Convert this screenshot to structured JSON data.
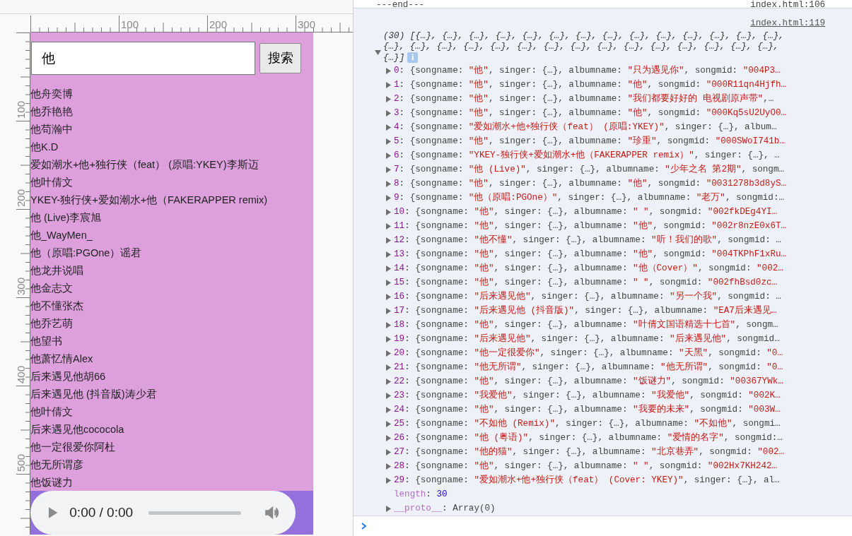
{
  "ruler": {
    "h_labels": [
      "100",
      "200",
      "300"
    ],
    "v_labels": [
      "100",
      "200",
      "300",
      "400",
      "500"
    ]
  },
  "app": {
    "search": {
      "value": "他"
    },
    "button": "搜索",
    "results": [
      {
        "text": "他舟奕博"
      },
      {
        "text": "他乔艳艳"
      },
      {
        "text": "他苟瀚中"
      },
      {
        "text": "他K.D"
      },
      {
        "text": "爱如潮水+他+独行侠（feat） (原唱:YKEY)李斯迈"
      },
      {
        "text": "他叶倩文"
      },
      {
        "text": "YKEY-独行侠+爱如潮水+他（FAKERAPPER remix)"
      },
      {
        "text": "他 (Live)李宸旭"
      },
      {
        "text": "他_WayMen_"
      },
      {
        "text": "他（原唱:PGOne）谣君"
      },
      {
        "text": "他龙井说唱"
      },
      {
        "text": "他金志文"
      },
      {
        "text": "他不懂张杰"
      },
      {
        "text": "他乔艺萌"
      },
      {
        "text": "他望书"
      },
      {
        "text": "他萧忆情Alex"
      },
      {
        "text": "后来遇见他胡66"
      },
      {
        "text": "后来遇见他 (抖音版)涛少君"
      },
      {
        "text": "他叶倩文"
      },
      {
        "text": "后来遇见他cococola"
      },
      {
        "text": "他一定很爱你阿杜"
      },
      {
        "text": "他无所谓彦"
      },
      {
        "text": "他饭谜力"
      }
    ],
    "player": {
      "time": "0:00 / 0:00"
    }
  },
  "console": {
    "prev": {
      "text": "---end---",
      "source": "index.html:106"
    },
    "source": "index.html:119",
    "summary": {
      "expanded": true,
      "lines": [
        "(30) [{…}, {…}, {…}, {…}, {…}, {…}, {…}, {…}, {…}, {…}, {…}, {…}, {…}, {…},",
        "{…}, {…}, {…}, {…}, {…}, {…}, {…}, {…}, {…}, {…}, {…}, {…}, {…}, {…}, {…},",
        "{…}]"
      ],
      "info": "i"
    },
    "rows": [
      {
        "index": "0",
        "expanded": false,
        "parts": [
          ": {songname: ",
          "\"他\"",
          ", singer: {…}, albumname: ",
          "\"只为遇见你\"",
          ", songmid: ",
          "\"004P3…"
        ]
      },
      {
        "index": "1",
        "expanded": false,
        "parts": [
          ": {songname: ",
          "\"他\"",
          ", singer: {…}, albumname: ",
          "\"他\"",
          ", songmid: ",
          "\"000R11qn4Hjfh…"
        ]
      },
      {
        "index": "2",
        "expanded": false,
        "parts": [
          ": {songname: ",
          "\"他\"",
          ", singer: {…}, albumname: ",
          "\"我们都要好好的 电视剧原声带\"",
          ",…"
        ]
      },
      {
        "index": "3",
        "expanded": false,
        "parts": [
          ": {songname: ",
          "\"他\"",
          ", singer: {…}, albumname: ",
          "\"他\"",
          ", songmid: ",
          "\"000Kq5sU2UyO0…"
        ]
      },
      {
        "index": "4",
        "expanded": false,
        "parts": [
          ": {songname: ",
          "\"爱如潮水+他+独行侠（feat） (原唱:YKEY)\"",
          ", singer: {…}, album…"
        ]
      },
      {
        "index": "5",
        "expanded": false,
        "parts": [
          ": {songname: ",
          "\"他\"",
          ", singer: {…}, albumname: ",
          "\"珍重\"",
          ", songmid: ",
          "\"000SWoI741b…"
        ]
      },
      {
        "index": "6",
        "expanded": false,
        "parts": [
          ": {songname: ",
          "\"YKEY-独行侠+爱如潮水+他（FAKERAPPER remix）\"",
          ", singer: {…}, …"
        ]
      },
      {
        "index": "7",
        "expanded": false,
        "parts": [
          ": {songname: ",
          "\"他 (Live)\"",
          ", singer: {…}, albumname: ",
          "\"少年之名 第2期\"",
          ", songm…"
        ]
      },
      {
        "index": "8",
        "expanded": false,
        "parts": [
          ": {songname: ",
          "\"他\"",
          ", singer: {…}, albumname: ",
          "\"他\"",
          ", songmid: ",
          "\"0031278b3d8yS…"
        ]
      },
      {
        "index": "9",
        "expanded": false,
        "parts": [
          ": {songname: ",
          "\"他（原唱:PGOne）\"",
          ", singer: {…}, albumname: ",
          "\"老万\"",
          ", songmid:…"
        ]
      },
      {
        "index": "10",
        "expanded": false,
        "parts": [
          ": {songname: ",
          "\"他\"",
          ", singer: {…}, albumname: ",
          "\"   \"",
          ", songmid: ",
          "\"002fkDEg4YI…"
        ]
      },
      {
        "index": "11",
        "expanded": false,
        "parts": [
          ": {songname: ",
          "\"他\"",
          ", singer: {…}, albumname: ",
          "\"他\"",
          ", songmid: ",
          "\"002r8nzE0x6T…"
        ]
      },
      {
        "index": "12",
        "expanded": false,
        "parts": [
          ": {songname: ",
          "\"他不懂\"",
          ", singer: {…}, albumname: ",
          "\"听！我们的歌\"",
          ", songmid: …"
        ]
      },
      {
        "index": "13",
        "expanded": false,
        "parts": [
          ": {songname: ",
          "\"他\"",
          ", singer: {…}, albumname: ",
          "\"他\"",
          ", songmid: ",
          "\"004TKPhF1xRu…"
        ]
      },
      {
        "index": "14",
        "expanded": false,
        "parts": [
          ": {songname: ",
          "\"他\"",
          ", singer: {…}, albumname: ",
          "\"他（Cover）\"",
          ", songmid: ",
          "\"002…"
        ]
      },
      {
        "index": "15",
        "expanded": false,
        "parts": [
          ": {songname: ",
          "\"他\"",
          ", singer: {…}, albumname: ",
          "\"   \"",
          ", songmid: ",
          "\"002fhBsd0zc…"
        ]
      },
      {
        "index": "16",
        "expanded": false,
        "parts": [
          ": {songname: ",
          "\"后来遇见他\"",
          ", singer: {…}, albumname: ",
          "\"另一个我\"",
          ", songmid: …"
        ]
      },
      {
        "index": "17",
        "expanded": false,
        "parts": [
          ": {songname: ",
          "\"后来遇见他 (抖音版)\"",
          ", singer: {…}, albumname: ",
          "\"EA7后来遇见…"
        ]
      },
      {
        "index": "18",
        "expanded": false,
        "parts": [
          ": {songname: ",
          "\"他\"",
          ", singer: {…}, albumname: ",
          "\"叶倩文国语精选十七首\"",
          ", songm…"
        ]
      },
      {
        "index": "19",
        "expanded": false,
        "parts": [
          ": {songname: ",
          "\"后来遇见他\"",
          ", singer: {…}, albumname: ",
          "\"后来遇见他\"",
          ", songmid…"
        ]
      },
      {
        "index": "20",
        "expanded": false,
        "parts": [
          ": {songname: ",
          "\"他一定很爱你\"",
          ", singer: {…}, albumname: ",
          "\"天黑\"",
          ", songmid: ",
          "\"0…"
        ]
      },
      {
        "index": "21",
        "expanded": false,
        "parts": [
          ": {songname: ",
          "\"他无所谓\"",
          ", singer: {…}, albumname: ",
          "\"他无所谓\"",
          ", songmid: ",
          "\"0…"
        ]
      },
      {
        "index": "22",
        "expanded": false,
        "parts": [
          ": {songname: ",
          "\"他\"",
          ", singer: {…}, albumname: ",
          "\"饭谜力\"",
          ", songmid: ",
          "\"00367YWk…"
        ]
      },
      {
        "index": "23",
        "expanded": false,
        "parts": [
          ": {songname: ",
          "\"我爱他\"",
          ", singer: {…}, albumname: ",
          "\"我爱他\"",
          ", songmid: ",
          "\"002K…"
        ]
      },
      {
        "index": "24",
        "expanded": false,
        "parts": [
          ": {songname: ",
          "\"他\"",
          ", singer: {…}, albumname: ",
          "\"我要的未来\"",
          ", songmid: ",
          "\"003W…"
        ]
      },
      {
        "index": "25",
        "expanded": false,
        "parts": [
          ": {songname: ",
          "\"不如他 (Remix)\"",
          ", singer: {…}, albumname: ",
          "\"不如他\"",
          ", songmi…"
        ]
      },
      {
        "index": "26",
        "expanded": false,
        "parts": [
          ": {songname: ",
          "\"他 (粤语)\"",
          ", singer: {…}, albumname: ",
          "\"爱情的名字\"",
          ", songmid:…"
        ]
      },
      {
        "index": "27",
        "expanded": false,
        "parts": [
          ": {songname: ",
          "\"他的猫\"",
          ", singer: {…}, albumname: ",
          "\"北京巷弄\"",
          ", songmid: ",
          "\"002…"
        ]
      },
      {
        "index": "28",
        "expanded": false,
        "parts": [
          ": {songname: ",
          "\"他\"",
          ", singer: {…}, albumname: ",
          "\"   \"",
          ", songmid: ",
          "\"002Hx7KH242…"
        ]
      },
      {
        "index": "29",
        "expanded": false,
        "parts": [
          ": {songname: ",
          "\"爱如潮水+他+独行侠（feat） (Cover: YKEY)\"",
          ", singer: {…}, al…"
        ]
      }
    ],
    "length": [
      {
        "kind": "prop",
        "text": "length"
      },
      {
        "kind": "punct",
        "text": ": "
      },
      {
        "kind": "number",
        "text": "30"
      }
    ],
    "proto": {
      "expanded": false,
      "parts": [
        {
          "kind": "prop",
          "text": "__proto__"
        },
        {
          "kind": "punct",
          "text": ": Array(0)"
        }
      ]
    }
  }
}
